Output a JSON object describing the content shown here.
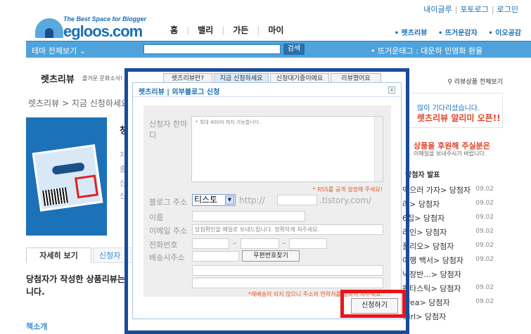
{
  "header": {
    "logo_tagline": "The Best Space for Blogger",
    "logo_name": "egloos.com",
    "top_links": [
      "내이글루",
      "포토로그",
      "로그인"
    ],
    "main_nav": [
      "홈",
      "밸리",
      "가든",
      "마이"
    ],
    "sub_nav": [
      "렛츠리뷰",
      "뜨거운감자",
      "이오공감"
    ]
  },
  "searchbar": {
    "theme_label": "테마 전체보기",
    "search_placeholder": "",
    "search_button": "검색",
    "hot_tag": "뜨거운태그 : 대운하 민영화 환율"
  },
  "page": {
    "title": "렛츠리뷰",
    "subtitle": "즐거운 문화소식!",
    "top_tabs": [
      "렛츠리뷰란?",
      "지금 신청하세요",
      "신청대기중이에요",
      "리뷰했어요"
    ],
    "all_reviews": "리뷰상품 전체보기",
    "breadcrumb": "렛츠리뷰 > 지금 신청하세요",
    "product_title": "청",
    "product_lines": [
      "저",
      "출",
      "신",
      "신"
    ],
    "tab_detail": "자세히 보기",
    "tab_winner": "신청자",
    "body_text": "당첨자가 작성한 상품리뷰는 니다.",
    "intro": "책소개"
  },
  "side": {
    "banner1_line1": "많이 기다리셨습니다.",
    "banner1_line2": "렛츠리뷰 알리미 오픈!!",
    "banner2_line1": "상품을 후원해 주실분은",
    "banner2_line2": "이메일을 보내주시기 바랍니다.",
    "winners_head": "당첨자 발표",
    "winners": [
      {
        "text": "먹으러 가자> 당첨자",
        "date": "09.02"
      },
      {
        "text": "라> 당첨자",
        "date": "09.02"
      },
      {
        "text": "6집> 당첨자",
        "date": "09.02"
      },
      {
        "text": "라인> 당첨자",
        "date": "09.02"
      },
      {
        "text": "폴리오> 당첨자",
        "date": "09.02"
      },
      {
        "text": "여행 백서> 당첨자",
        "date": "09.02"
      },
      {
        "text": "넉장반...> 당첨자",
        "date": ""
      },
      {
        "text": "판타스틱> 당첨자",
        "date": "09.02"
      },
      {
        "text": "orea> 당첨자",
        "date": "09.02"
      },
      {
        "text": "Girl> 당첨자",
        "date": ""
      }
    ]
  },
  "dialog": {
    "title": "렛츠리뷰 | 외부블로그 신청",
    "close_label": "x",
    "labels": {
      "comment": "신청자 한마디",
      "blog": "블로그 주소",
      "name": "이름",
      "email": "이메일 주소",
      "phone": "전화번호",
      "address": "배송시주소"
    },
    "comment_placeholder": "* 최대 400자 까지 가능합니다.",
    "rss_note": "* RSS를 공개 설정해 주세요!",
    "blog_type": "티스토",
    "blog_prefix": "http://",
    "blog_suffix": ".tistory.com/",
    "email_placeholder": "당첨확인을 메일로 보내드립니다. 정확하게 쳐주세요.",
    "zip_button": "우편번호찾기",
    "address_note": "*재배송이 되지 않으니 주소와 연락처를 정확히 쳐주세요.",
    "apply_button": "신청하기"
  },
  "colors": {
    "highlight_blue": "#1a4a9c",
    "highlight_red": "#e8151a",
    "brand": "#1b6fb5"
  }
}
